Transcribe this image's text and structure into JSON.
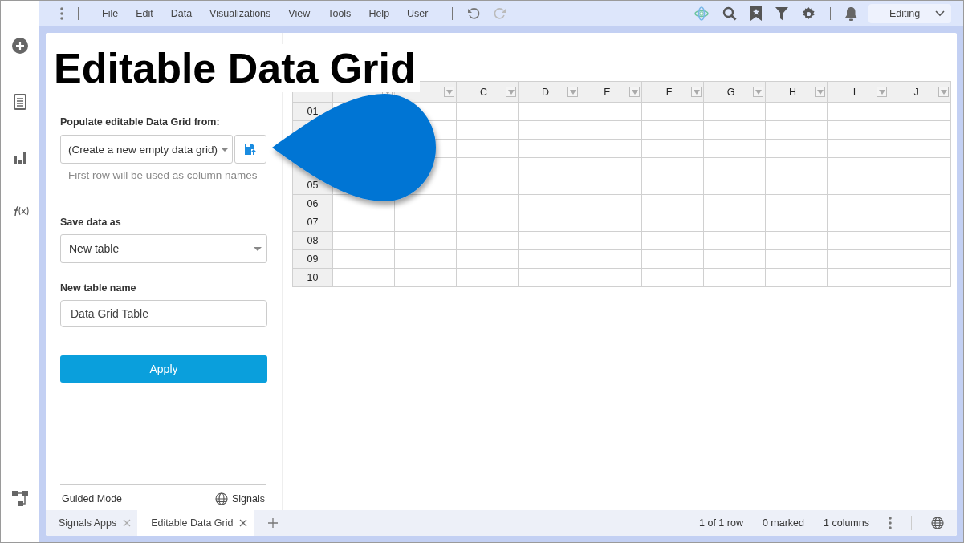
{
  "toolbar": {
    "menu": [
      "File",
      "Edit",
      "Data",
      "Visualizations",
      "View",
      "Tools",
      "Help",
      "User"
    ],
    "mode_select": {
      "value": "Editing"
    }
  },
  "title_overlay": "Editable Data Grid",
  "panel": {
    "source_label": "Populate editable Data Grid from:",
    "source_select": {
      "value": "(Create a new empty data grid)"
    },
    "source_hint": "First row will be used as column names",
    "save_label": "Save data as",
    "save_select": {
      "value": "New table"
    },
    "name_label": "New table name",
    "name_field": {
      "value": "Data Grid Table"
    },
    "apply_button": "Apply",
    "footer": {
      "mode": "Guided Mode",
      "brand": "Signals"
    }
  },
  "grid": {
    "columns": [
      null,
      null,
      "C",
      "D",
      "E",
      "F",
      "G",
      "H",
      "I",
      "J"
    ],
    "rows": [
      "01",
      null,
      null,
      null,
      "05",
      "06",
      "07",
      "08",
      "09",
      "10"
    ]
  },
  "tabs": [
    {
      "label": "Signals Apps",
      "selected": false
    },
    {
      "label": "Editable Data Grid",
      "selected": true
    }
  ],
  "status_bar": {
    "rows": "1 of 1 row",
    "marked": "0 marked",
    "columns": "1 columns"
  }
}
